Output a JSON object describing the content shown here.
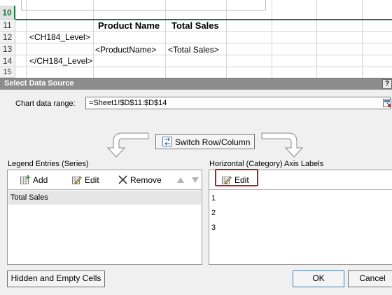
{
  "sheet": {
    "rows": [
      "10",
      "11",
      "12",
      "13",
      "14",
      "15"
    ],
    "chart_axis_ticks": [
      "1",
      "2",
      "3"
    ],
    "cells": {
      "product_name_header": "Product Name",
      "total_sales_header": "Total Sales",
      "level_open": "<CH184_Level>",
      "product_name_field": "<ProductName>",
      "total_sales_field": "<Total Sales>",
      "level_close": "</CH184_Level>"
    }
  },
  "dialog": {
    "title": "Select Data Source",
    "help_label": "?",
    "chart_data_range_label": "Chart data range:",
    "chart_data_range_value": "=Sheet1!$D$11:$D$14",
    "switch_button_label": "Switch Row/Column",
    "legend_header": "Legend Entries (Series)",
    "legend_toolbar": {
      "add_label": "Add",
      "edit_label": "Edit",
      "remove_label": "Remove"
    },
    "series": [
      "Total Sales"
    ],
    "axis_header": "Horizontal (Category) Axis Labels",
    "axis_edit_label": "Edit",
    "axis_labels": [
      "1",
      "2",
      "3"
    ],
    "hidden_empty_label": "Hidden and Empty Cells",
    "ok_label": "OK",
    "cancel_label": "Cancel"
  },
  "colors": {
    "excel_green": "#217346",
    "highlight_red": "#c0171c",
    "titlebar_gray": "#8c8c8c"
  }
}
